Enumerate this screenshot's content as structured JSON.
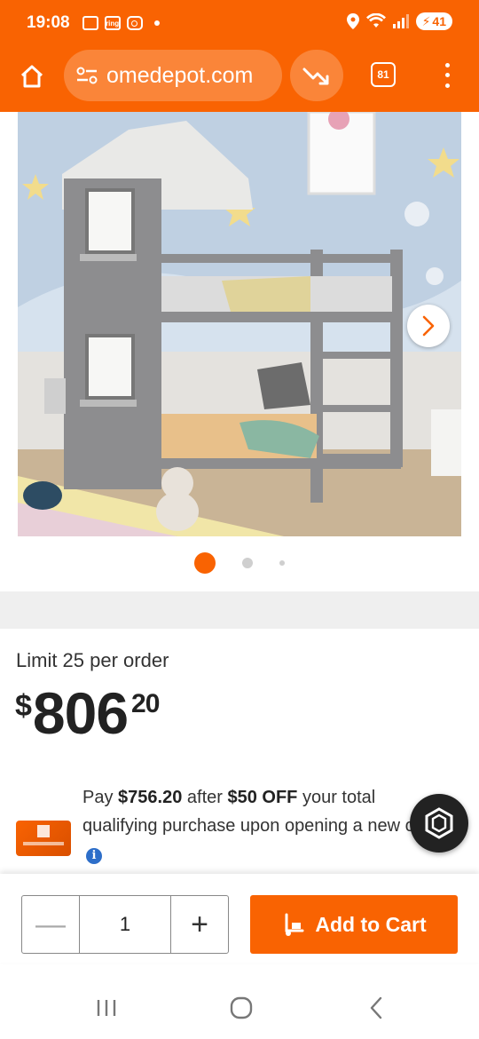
{
  "status_bar": {
    "time": "19:08",
    "notif_ring": "ring",
    "battery_level": "41"
  },
  "browser": {
    "url": "omedepot.com",
    "tab_count": "81"
  },
  "product": {
    "image_alt": "Gray wooden house-style bunk bed in a child's bedroom",
    "gallery_total": 3,
    "gallery_active": 1
  },
  "pricing": {
    "limit_text": "Limit 25 per order",
    "currency": "$",
    "price_whole": "806",
    "price_cents": "20"
  },
  "promo": {
    "pay_prefix": "Pay ",
    "pay_amount": "$756.20",
    "after_text": " after ",
    "off_amount": "$50 OFF",
    "rest_text": " your total qualifying purchase upon opening a new card.",
    "info_glyph": "i"
  },
  "cart": {
    "quantity": "1",
    "minus_glyph": "—",
    "plus_glyph": "+",
    "add_label": "Add to Cart"
  },
  "colors": {
    "brand_orange": "#f96302",
    "info_blue": "#2d6ec9"
  }
}
